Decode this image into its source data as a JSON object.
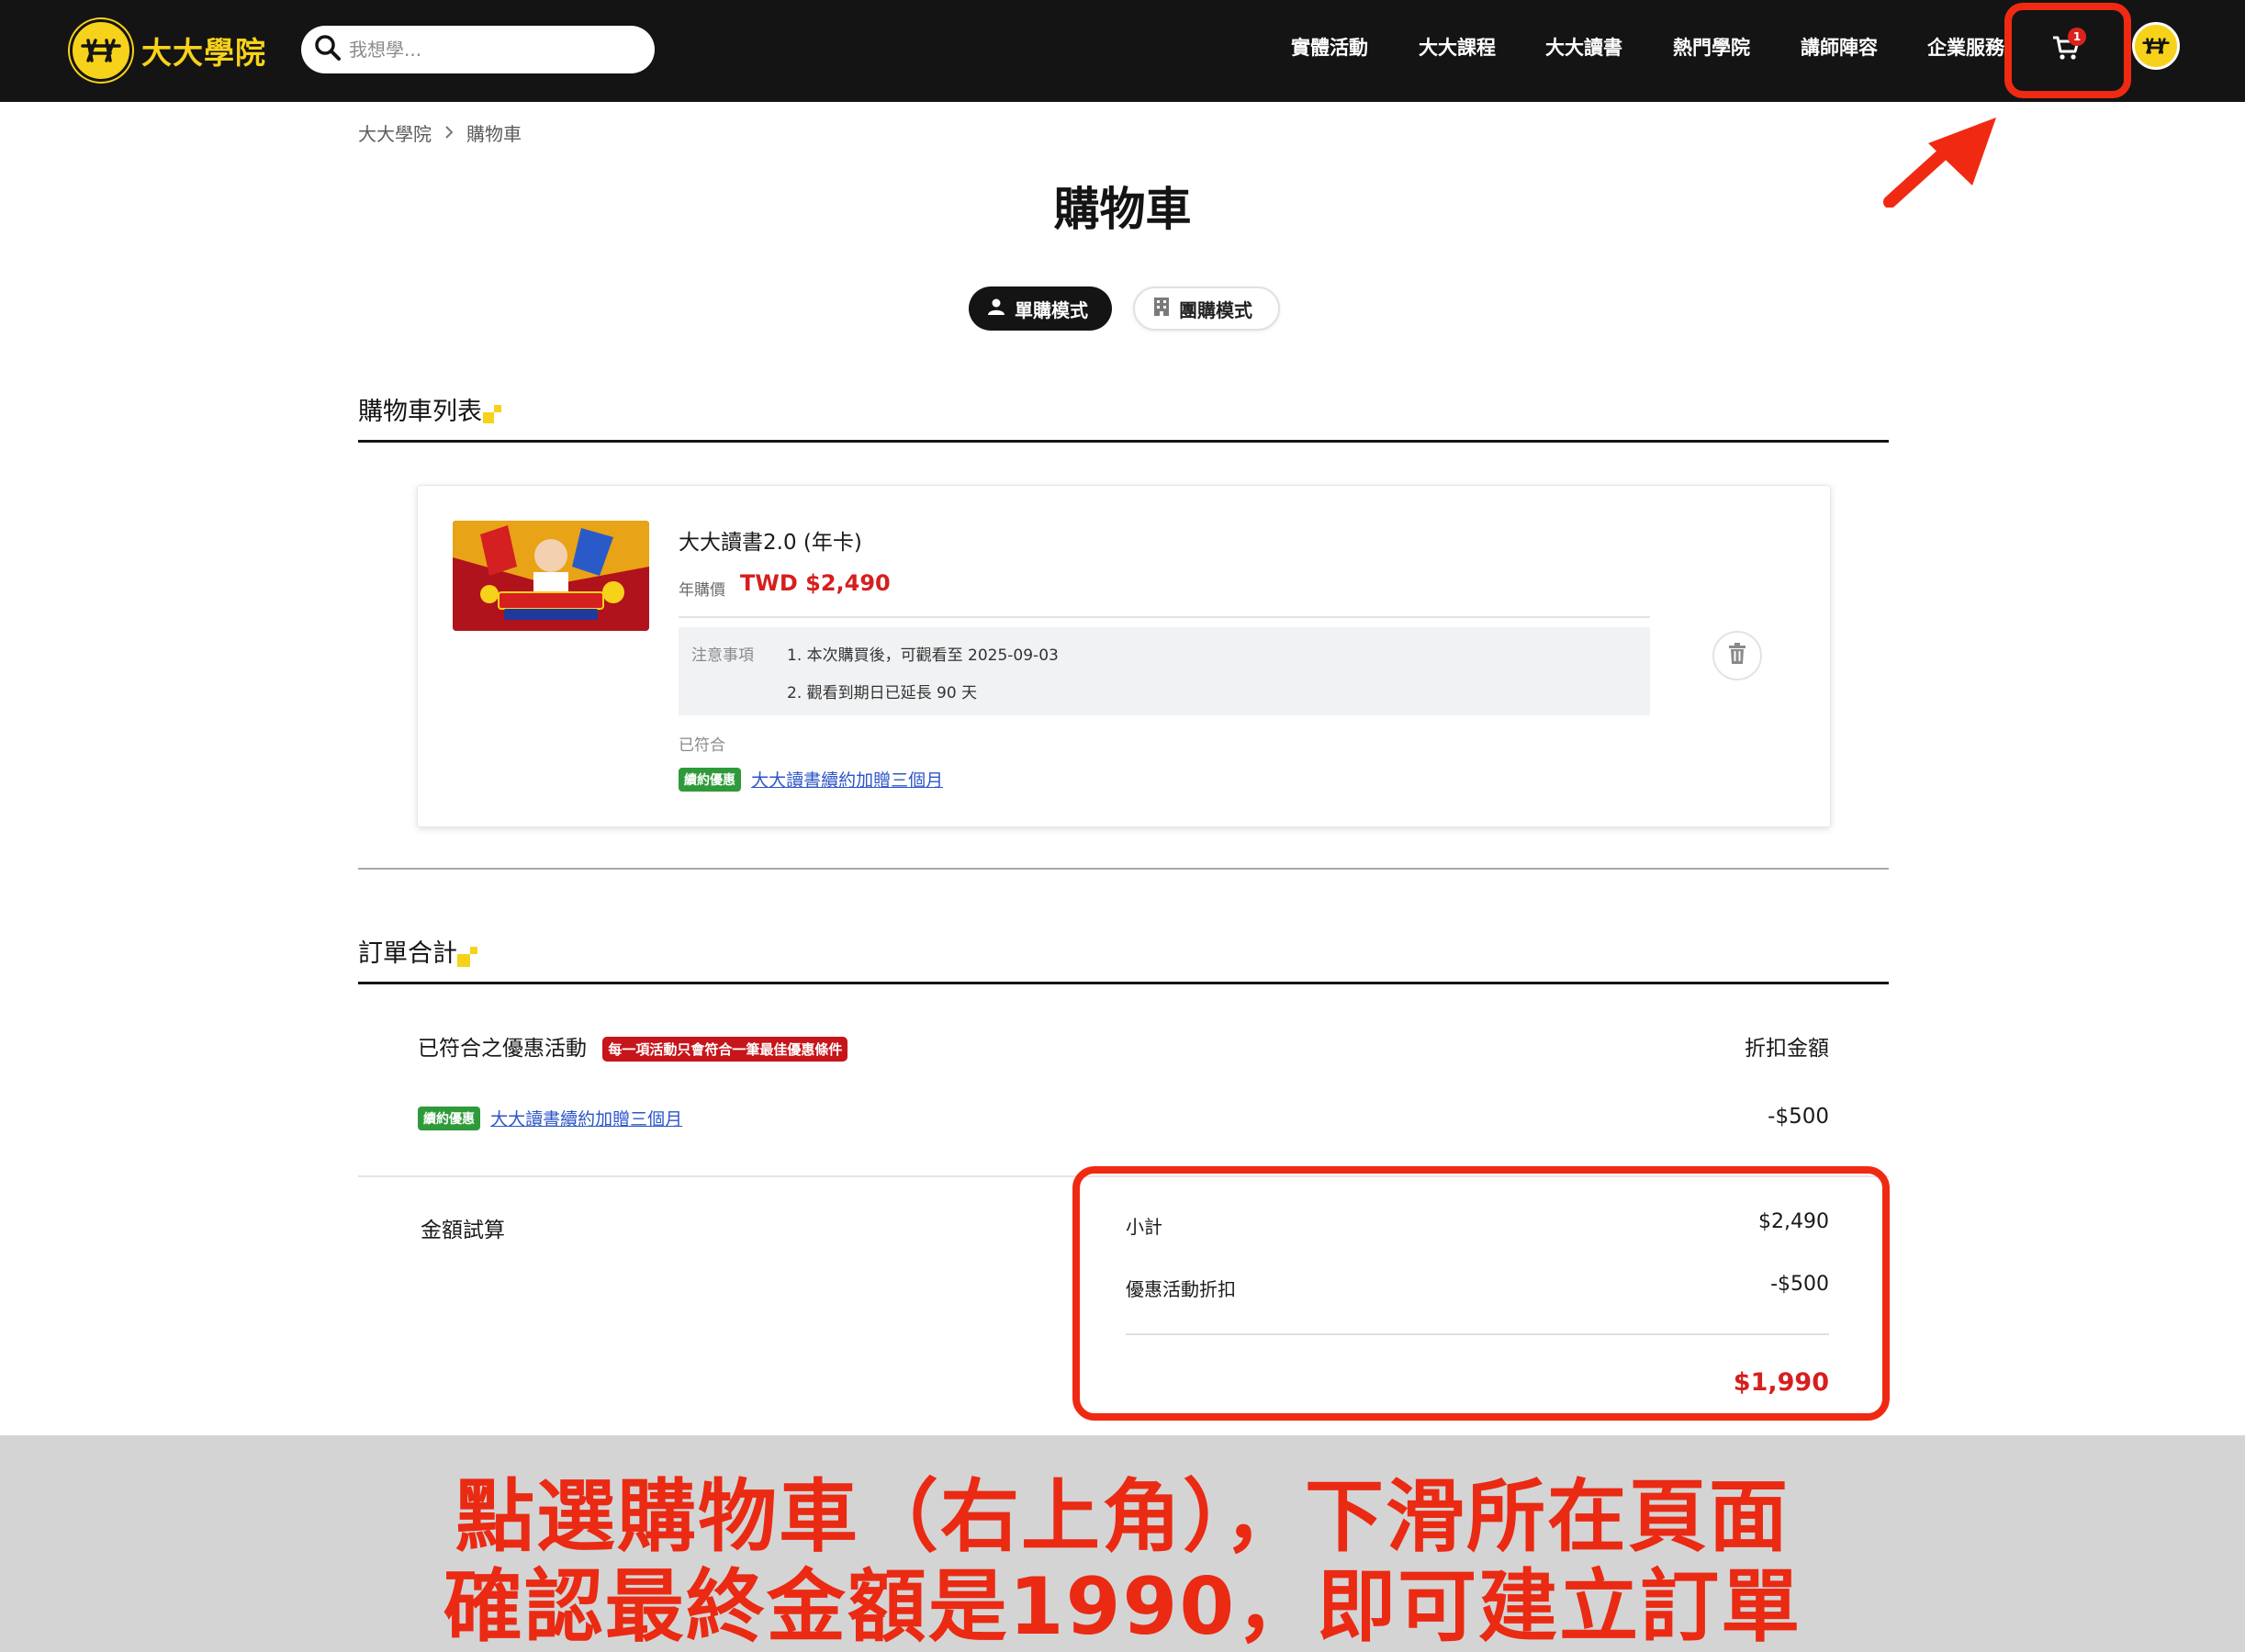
{
  "header": {
    "logo_text": "大大學院",
    "search": {
      "placeholder": "我想學..."
    },
    "nav": [
      "實體活動",
      "大大課程",
      "大大讀書",
      "熱門學院",
      "講師陣容",
      "企業服務"
    ],
    "cart_count": "1"
  },
  "breadcrumb": {
    "home": "大大學院",
    "current": "購物車"
  },
  "page": {
    "title": "購物車",
    "modes": {
      "single": "單購模式",
      "group": "團購模式"
    }
  },
  "cart": {
    "section_title": "購物車列表",
    "item": {
      "name": "大大讀書2.0 (年卡)",
      "price_label": "年購價",
      "price": "TWD $2,490",
      "notes_label": "注意事項",
      "notes": [
        "1. 本次購買後，可觀看至 2025-09-03",
        "2. 觀看到期日已延長 90 天"
      ],
      "matched_label": "已符合",
      "promo_tag": "續約優惠",
      "promo_name": "大大讀書續約加贈三個月"
    }
  },
  "summary": {
    "section_title": "訂單合計",
    "promos_heading": "已符合之優惠活動",
    "promos_warning": "每一項活動只會符合一筆最佳優惠條件",
    "discount_heading": "折扣金額",
    "promo_tag": "續約優惠",
    "promo_name": "大大讀書續約加贈三個月",
    "promo_amount": "-$500",
    "calc_label": "金額試算",
    "subtotal_label": "小計",
    "subtotal": "$2,490",
    "discount_label": "優惠活動折扣",
    "discount": "-$500",
    "total": "$1,990"
  },
  "instruction": {
    "line1": "點選購物車（右上角），下滑所在頁面",
    "line2": "確認最終金額是1990，即可建立訂單"
  },
  "colors": {
    "brand_yellow": "#f7d21a",
    "price_red": "#d61f1f",
    "annotation_red": "#f02a12",
    "promo_green": "#2f9a3a"
  }
}
